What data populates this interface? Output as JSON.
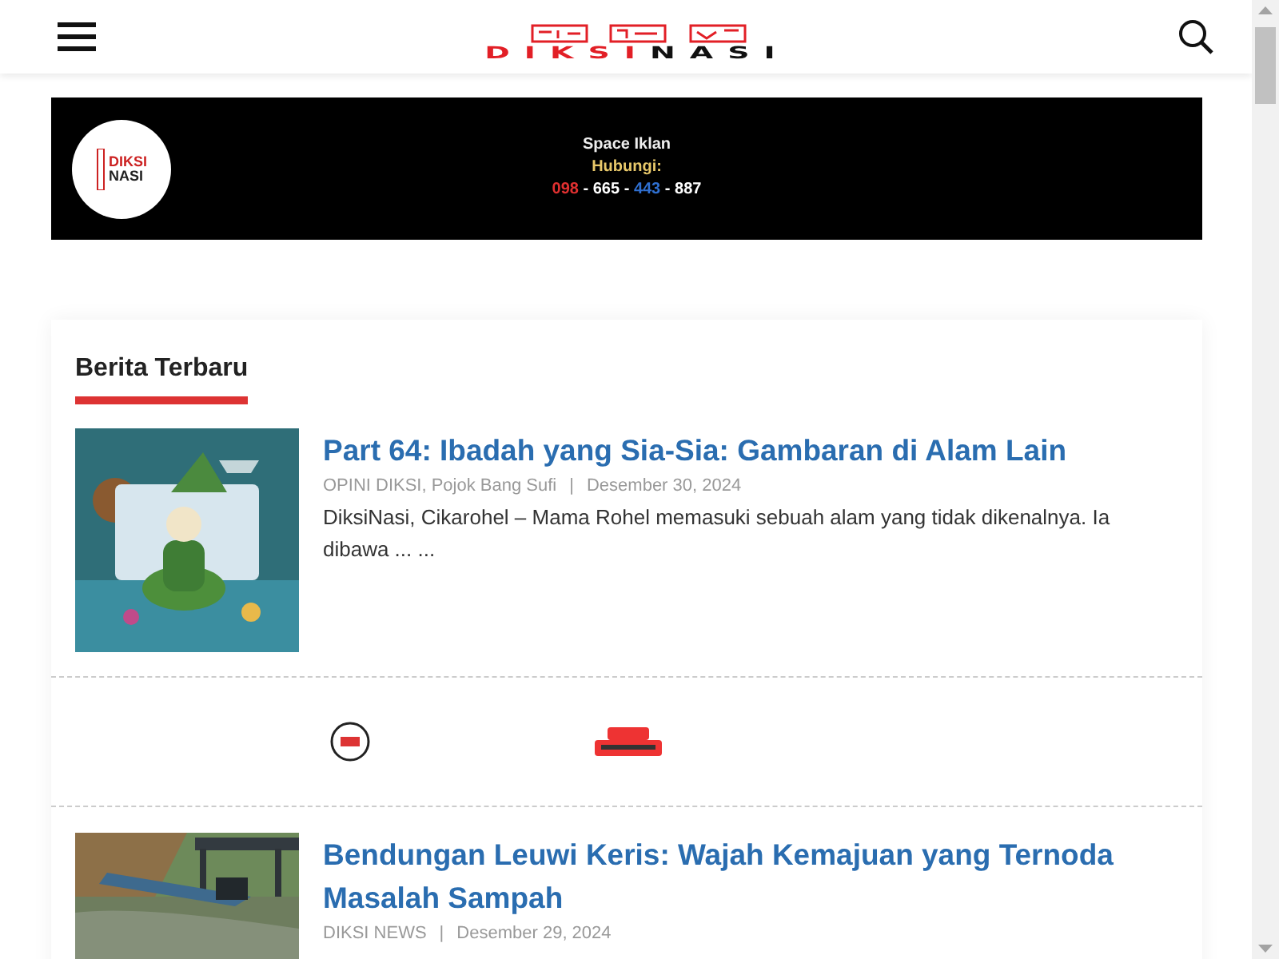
{
  "header": {
    "logo": {
      "part_1": "DIKSI",
      "part_2": "NASI"
    }
  },
  "banner": {
    "logo": {
      "line_1": "DIKSI",
      "line_2": "NASI"
    },
    "title": "Space Iklan",
    "subtitle": "Hubungi:",
    "phone": [
      {
        "text": "098",
        "color": "#e03030"
      },
      {
        "text": " - ",
        "color": "#ffffff"
      },
      {
        "text": "665",
        "color": "#ffffff"
      },
      {
        "text": " - ",
        "color": "#ffffff"
      },
      {
        "text": "443",
        "color": "#2f6fd0"
      },
      {
        "text": " - ",
        "color": "#ffffff"
      },
      {
        "text": "887",
        "color": "#ffffff"
      }
    ]
  },
  "section": {
    "title": "Berita Terbaru"
  },
  "articles": [
    {
      "kind": "post",
      "title": "Part 64: Ibadah yang Sia-Sia: Gambaran di Alam Lain",
      "categories": "OPINI DIKSI, Pojok Bang Sufi",
      "separator": "|",
      "date": "Desember 30, 2024",
      "excerpt": "DiksiNasi, Cikarohel – Mama Rohel memasuki sebuah alam yang tidak dikenalnya. Ia dibawa ... ..."
    },
    {
      "kind": "ads"
    },
    {
      "kind": "post",
      "title": "Bendungan Leuwi Keris: Wajah Kemajuan yang Ternoda Masalah Sampah",
      "categories": "DIKSI NEWS",
      "separator": "|",
      "date": "Desember 29, 2024"
    }
  ]
}
